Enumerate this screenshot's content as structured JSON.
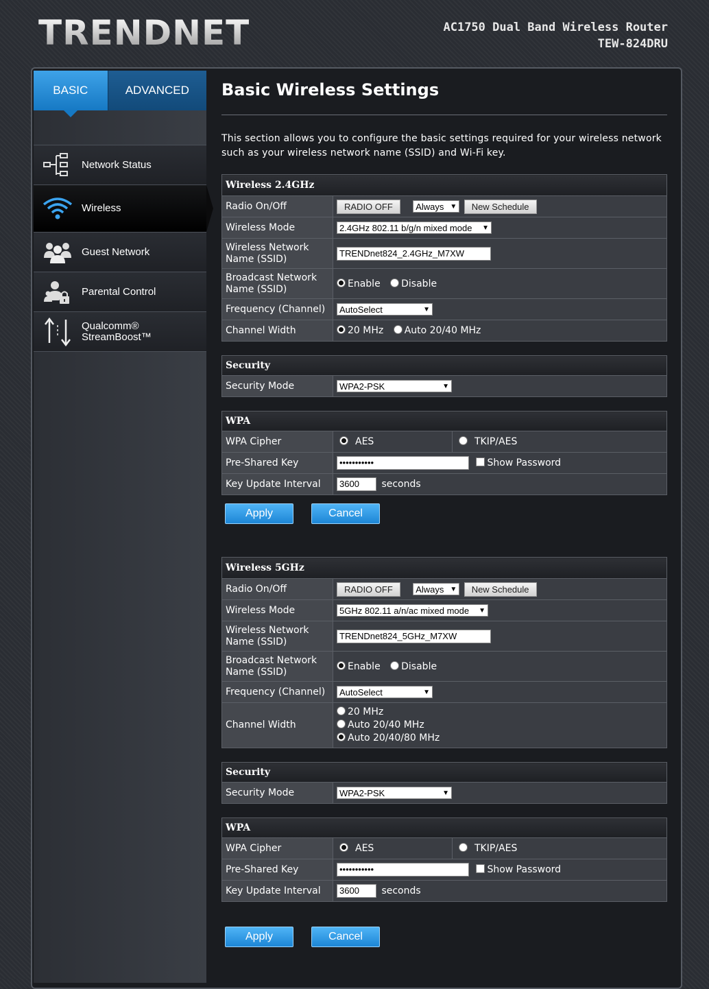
{
  "header": {
    "logo": "TRENDNET",
    "product_line1": "AC1750 Dual Band Wireless Router",
    "product_line2": "TEW-824DRU"
  },
  "sidebar": {
    "tabs": [
      {
        "label": "BASIC"
      },
      {
        "label": "ADVANCED"
      }
    ],
    "items": [
      {
        "label": "Network Status",
        "icon": "network-status-icon"
      },
      {
        "label": "Wireless",
        "icon": "wifi-icon"
      },
      {
        "label": "Guest Network",
        "icon": "users-icon"
      },
      {
        "label": "Parental Control",
        "icon": "parental-lock-icon"
      },
      {
        "label": "Qualcomm®",
        "label2": "StreamBoost™",
        "icon": "streamboost-icon"
      }
    ]
  },
  "page": {
    "title": "Basic Wireless Settings",
    "description": "This section allows you to configure the basic settings required for your wireless network such as your wireless network name (SSID) and Wi-Fi key."
  },
  "labels": {
    "radio": "Radio On/Off",
    "mode": "Wireless Mode",
    "ssid": "Wireless Network Name (SSID)",
    "broadcast": "Broadcast Network Name (SSID)",
    "frequency": "Frequency (Channel)",
    "width": "Channel Width",
    "security_title": "Security",
    "security_mode": "Security Mode",
    "wpa_title": "WPA",
    "cipher": "WPA Cipher",
    "psk": "Pre-Shared Key",
    "key_interval": "Key Update Interval",
    "radio_off": "RADIO OFF",
    "new_schedule": "New Schedule",
    "enable": "Enable",
    "disable": "Disable",
    "aes": "AES",
    "tkip": "TKIP/AES",
    "show_password": "Show Password",
    "seconds": "seconds",
    "apply": "Apply",
    "cancel": "Cancel"
  },
  "w24": {
    "title": "Wireless 2.4GHz",
    "schedule": "Always",
    "mode": "2.4GHz 802.11 b/g/n mixed mode",
    "ssid": "TRENDnet824_2.4GHz_M7XW",
    "broadcast": "Enable",
    "channel": "AutoSelect",
    "width_opt1": "20 MHz",
    "width_opt2": "Auto 20/40 MHz",
    "width_selected": "20 MHz",
    "security_mode": "WPA2-PSK",
    "cipher": "AES",
    "psk": "•••••••••••",
    "interval": "3600"
  },
  "w5": {
    "title": "Wireless 5GHz",
    "schedule": "Always",
    "mode": "5GHz 802.11 a/n/ac mixed mode",
    "ssid": "TRENDnet824_5GHz_M7XW",
    "broadcast": "Enable",
    "channel": "AutoSelect",
    "width_opt1": "20 MHz",
    "width_opt2": "Auto 20/40 MHz",
    "width_opt3": "Auto 20/40/80 MHz",
    "width_selected": "Auto 20/40/80 MHz",
    "security_mode": "WPA2-PSK",
    "cipher": "AES",
    "psk": "•••••••••••",
    "interval": "3600"
  }
}
